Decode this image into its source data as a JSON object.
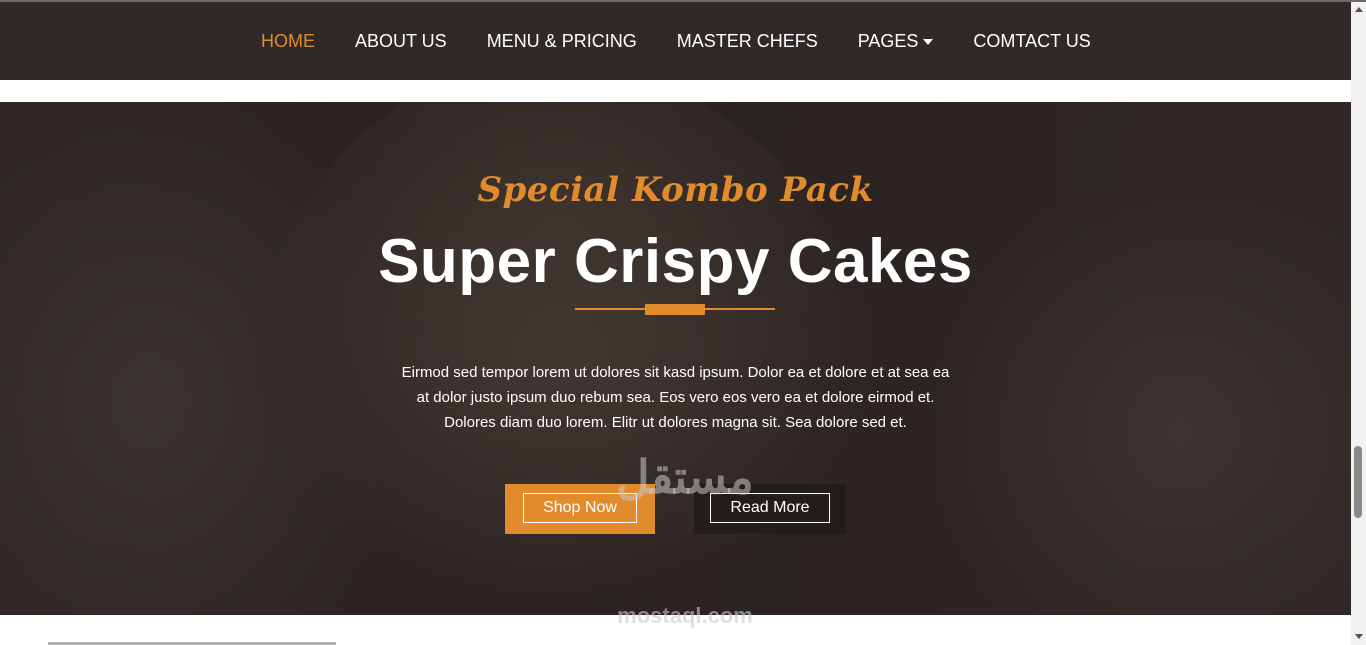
{
  "nav": {
    "items": [
      {
        "label": "HOME",
        "active": true
      },
      {
        "label": "ABOUT US"
      },
      {
        "label": "MENU & PRICING"
      },
      {
        "label": "MASTER CHEFS"
      },
      {
        "label": "PAGES",
        "has_dropdown": true
      },
      {
        "label": "COMTACT US"
      }
    ]
  },
  "hero": {
    "subtitle": "Special Kombo Pack",
    "title": "Super Crispy Cakes",
    "description_lines": [
      "Eirmod sed tempor lorem ut dolores sit kasd ipsum. Dolor ea et dolore et at sea ea",
      "at dolor justo ipsum duo rebum sea. Eos vero eos vero ea et dolore eirmod et.",
      "Dolores diam duo lorem. Elitr ut dolores magna sit. Sea dolore sed et."
    ],
    "buttons": {
      "shop_label": "Shop Now",
      "read_label": "Read More"
    }
  },
  "watermark": {
    "arabic": "مستقل",
    "latin": "mostaql.com"
  },
  "colors": {
    "accent": "#e28b2d",
    "navbar": "#2f2a27",
    "hero_bg": "#2d2624"
  },
  "icons": {
    "pages_dropdown": "caret-down-icon"
  }
}
